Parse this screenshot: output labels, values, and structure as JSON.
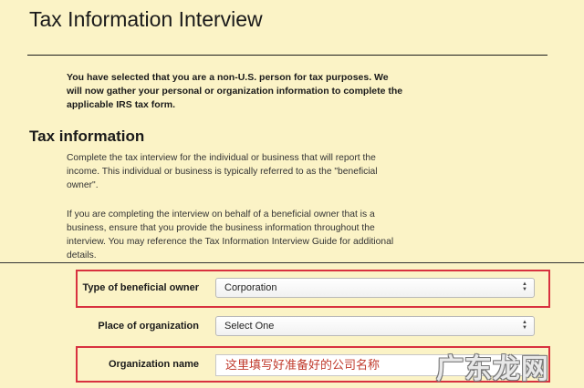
{
  "header": {
    "title": "Tax Information Interview"
  },
  "intro": {
    "text": "You have selected that you are a non-U.S. person for tax purposes. We will now gather your personal or organization information to complete the applicable IRS tax form."
  },
  "tax_info": {
    "title": "Tax information",
    "para1": "Complete the tax interview for the individual or business that will report the income. This individual or business is typically referred to as the \"beneficial owner\".",
    "para2": "If you are completing the interview on behalf of a beneficial owner that is a business, ensure that you provide the business information throughout the interview. You may reference the Tax Information Interview Guide for additional details."
  },
  "form": {
    "beneficial_owner": {
      "label": "Type of beneficial owner",
      "value": "Corporation"
    },
    "place_of_org": {
      "label": "Place of organization",
      "value": "Select One"
    },
    "org_name": {
      "label": "Organization name",
      "value": "这里填写好准备好的公司名称"
    }
  },
  "watermark": {
    "text": "广东龙网"
  },
  "colors": {
    "background": "#fbf3c6",
    "highlight": "#d8313f"
  }
}
